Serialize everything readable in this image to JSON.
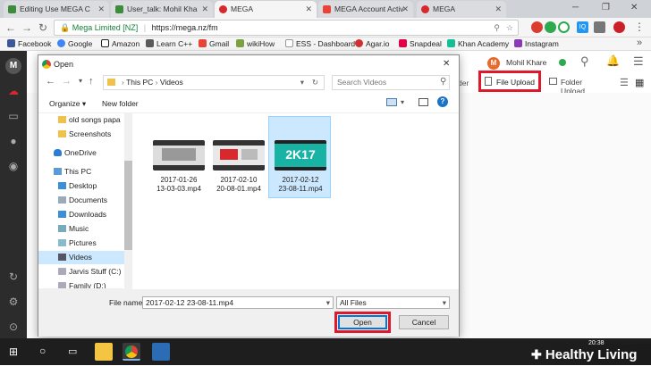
{
  "browser": {
    "tabs": [
      {
        "label": "Editing Use MEGA C",
        "color": "#3b8d3b"
      },
      {
        "label": "User_talk: Mohil Kha",
        "color": "#3b8d3b"
      },
      {
        "label": "MEGA",
        "color": "#d9272e",
        "active": true
      },
      {
        "label": "MEGA Account Activ",
        "color": "#ea4335"
      },
      {
        "label": "MEGA",
        "color": "#d9272e"
      }
    ],
    "address": {
      "secure_label": "Mega Limited [NZ]",
      "url": "https://mega.nz/fm"
    },
    "bookmarks": [
      {
        "label": "Facebook",
        "color": "#3b5998"
      },
      {
        "label": "Google",
        "color": "#4285f4"
      },
      {
        "label": "Amazon",
        "color": "#222"
      },
      {
        "label": "Learn C++",
        "color": "#5a5a5a"
      },
      {
        "label": "Gmail",
        "color": "#ea4335"
      },
      {
        "label": "wikiHow",
        "color": "#7aa33f"
      },
      {
        "label": "ESS - Dashboard",
        "color": "#777"
      },
      {
        "label": "Agar.io",
        "color": "#d32f2f"
      },
      {
        "label": "Snapdeal",
        "color": "#e40046"
      },
      {
        "label": "Khan Academy",
        "color": "#14bf96"
      },
      {
        "label": "Instagram",
        "color": "#8a3ab9"
      }
    ]
  },
  "mega": {
    "user_name": "Mohil Khare",
    "avatar_letter": "M",
    "toolbar_partial": "der",
    "file_upload": "File Upload",
    "folder_upload": "Folder Upload"
  },
  "dialog": {
    "title": "Open",
    "breadcrumb": [
      "This PC",
      "Videos"
    ],
    "search_placeholder": "Search Videos",
    "organize": "Organize ▾",
    "new_folder": "New folder",
    "tree": [
      {
        "label": "old songs papa",
        "icon": "folder"
      },
      {
        "label": "Screenshots",
        "icon": "folder"
      },
      {
        "label": "OneDrive",
        "icon": "cloud"
      },
      {
        "label": "This PC",
        "icon": "pc"
      },
      {
        "label": "Desktop",
        "icon": "folder"
      },
      {
        "label": "Documents",
        "icon": "folder"
      },
      {
        "label": "Downloads",
        "icon": "folder"
      },
      {
        "label": "Music",
        "icon": "folder"
      },
      {
        "label": "Pictures",
        "icon": "folder"
      },
      {
        "label": "Videos",
        "icon": "folder",
        "selected": true
      },
      {
        "label": "Jarvis Stuff (C:)",
        "icon": "drive"
      },
      {
        "label": "Family (D:)",
        "icon": "drive"
      }
    ],
    "files": [
      {
        "line1": "2017-01-26",
        "line2": "13-03-03.mp4"
      },
      {
        "line1": "2017-02-10",
        "line2": "20-08-01.mp4"
      },
      {
        "line1": "2017-02-12",
        "line2": "23-08-11.mp4",
        "selected": true,
        "thumb_text": "2K17"
      }
    ],
    "file_name_label": "File name:",
    "file_name_value": "2017-02-12 23-08-11.mp4",
    "file_type": "All Files",
    "open_label": "Open",
    "cancel_label": "Cancel"
  },
  "taskbar": {
    "clock": "20:38"
  },
  "watermark": "Healthy Living"
}
